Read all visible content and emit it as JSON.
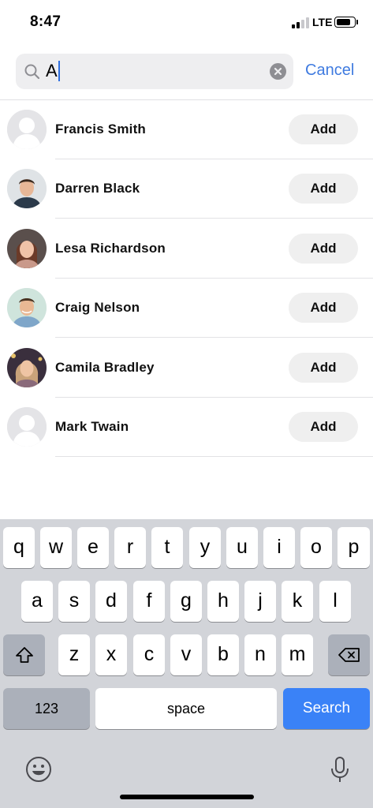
{
  "status_bar": {
    "time": "8:47",
    "network": "LTE",
    "battery_level": 0.8
  },
  "search": {
    "value": "A",
    "cancel_label": "Cancel"
  },
  "contacts": [
    {
      "name": "Francis Smith",
      "add_label": "Add",
      "avatar": "placeholder-avatar"
    },
    {
      "name": "Darren Black",
      "add_label": "Add",
      "avatar": "photo-avatar"
    },
    {
      "name": "Lesa Richardson",
      "add_label": "Add",
      "avatar": "photo-avatar"
    },
    {
      "name": "Craig Nelson",
      "add_label": "Add",
      "avatar": "photo-avatar"
    },
    {
      "name": "Camila Bradley",
      "add_label": "Add",
      "avatar": "photo-avatar"
    },
    {
      "name": "Mark Twain",
      "add_label": "Add",
      "avatar": "placeholder-avatar"
    }
  ],
  "keyboard": {
    "row1": [
      "q",
      "w",
      "e",
      "r",
      "t",
      "y",
      "u",
      "i",
      "o",
      "p"
    ],
    "row2": [
      "a",
      "s",
      "d",
      "f",
      "g",
      "h",
      "j",
      "k",
      "l"
    ],
    "row3": [
      "z",
      "x",
      "c",
      "v",
      "b",
      "n",
      "m"
    ],
    "numbers_label": "123",
    "space_label": "space",
    "search_label": "Search"
  },
  "colors": {
    "accent": "#3f7be0",
    "search_key": "#3a82f7",
    "keyboard_bg": "#d2d4d9"
  }
}
